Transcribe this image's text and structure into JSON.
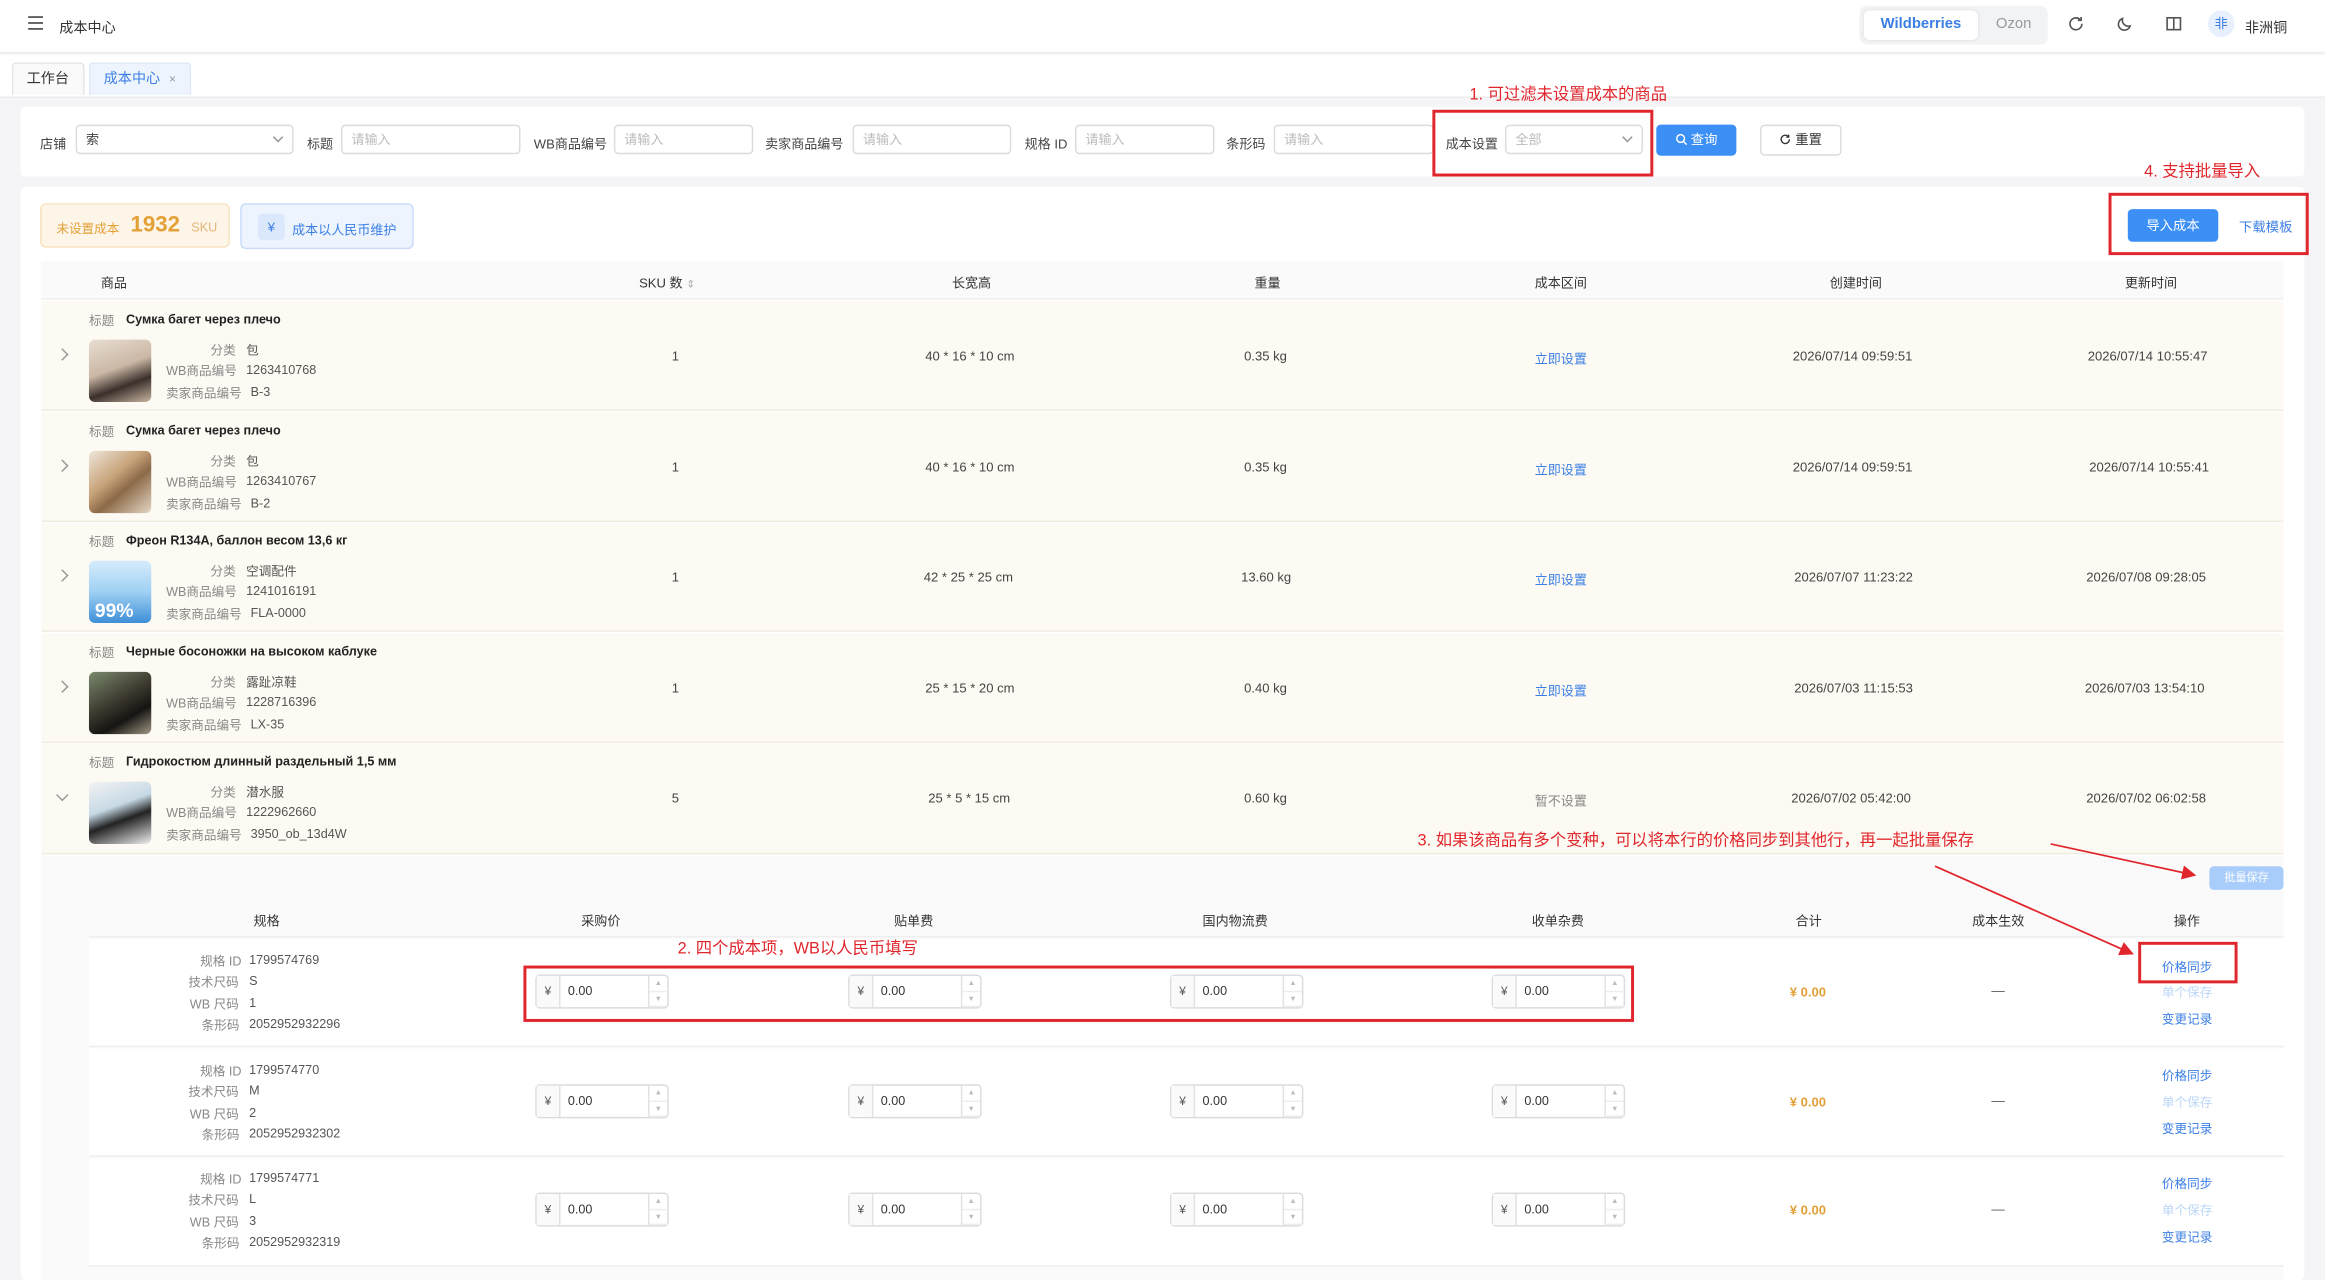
{
  "header": {
    "app_title": "成本中心",
    "platforms": [
      "Wildberries",
      "Ozon"
    ],
    "user_initial": "非",
    "user_name": "非洲铜"
  },
  "tabs": [
    {
      "label": "工作台"
    },
    {
      "label": "成本中心",
      "close": "×"
    }
  ],
  "filters": {
    "store_label": "店铺",
    "store_value": "索",
    "title_label": "标题",
    "title_placeholder": "请输入",
    "wb_id_label": "WB商品编号",
    "wb_id_placeholder": "请输入",
    "seller_id_label": "卖家商品编号",
    "seller_id_placeholder": "请输入",
    "spec_id_label": "规格 ID",
    "spec_id_placeholder": "请输入",
    "barcode_label": "条形码",
    "barcode_placeholder": "请输入",
    "cost_label": "成本设置",
    "cost_value": "全部",
    "query_button": "查询",
    "reset_button": "重置"
  },
  "summary": {
    "unset_label": "未设置成本",
    "unset_count": "1932",
    "unset_unit": "SKU",
    "rmb_symbol": "¥",
    "rmb_label": "成本以人民币维护",
    "import_button": "导入成本",
    "template_link": "下载模板"
  },
  "table": {
    "columns": [
      "商品",
      "SKU 数",
      "长宽高",
      "重量",
      "成本区间",
      "创建时间",
      "更新时间"
    ],
    "labels": {
      "title": "标题",
      "category": "分类",
      "wb_id": "WB商品编号",
      "seller_id": "卖家商品编号"
    },
    "rows": [
      {
        "title": "Сумка багет через плечо",
        "category": "包",
        "wb_id": "1263410768",
        "seller_id": "B-3",
        "sku": "1",
        "dims": "40 * 16 * 10 cm",
        "weight": "0.35 kg",
        "cost": "立即设置",
        "created": "2026/07/14 09:59:51",
        "updated": "2026/07/14 10:55:47"
      },
      {
        "title": "Сумка багет через плечо",
        "category": "包",
        "wb_id": "1263410767",
        "seller_id": "B-2",
        "sku": "1",
        "dims": "40 * 16 * 10 cm",
        "weight": "0.35 kg",
        "cost": "立即设置",
        "created": "2026/07/14 09:59:51",
        "updated": "2026/07/14 10:55:41"
      },
      {
        "title": "Фреон R134A, баллон весом 13,6 кг",
        "category": "空调配件",
        "wb_id": "1241016191",
        "seller_id": "FLA-0000",
        "sku": "1",
        "dims": "42 * 25 * 25 cm",
        "weight": "13.60 kg",
        "cost": "立即设置",
        "created": "2026/07/07 11:23:22",
        "updated": "2026/07/08 09:28:05",
        "thumb_text": "99%"
      },
      {
        "title": "Черные босоножки на высоком каблуке",
        "category": "露趾凉鞋",
        "wb_id": "1228716396",
        "seller_id": "LX-35",
        "sku": "1",
        "dims": "25 * 15 * 20 cm",
        "weight": "0.40 kg",
        "cost": "立即设置",
        "created": "2026/07/03 11:15:53",
        "updated": "2026/07/03 13:54:10"
      },
      {
        "title": "Гидрокостюм длинный раздельный 1,5 мм",
        "category": "潜水服",
        "wb_id": "1222962660",
        "seller_id": "3950_ob_13d4W",
        "sku": "5",
        "dims": "25 * 5 * 15 cm",
        "weight": "0.60 kg",
        "cost": "暂不设置",
        "created": "2026/07/02 05:42:00",
        "updated": "2026/07/02 06:02:58"
      }
    ]
  },
  "variants": {
    "batch_save": "批量保存",
    "columns": [
      "规格",
      "采购价",
      "贴单费",
      "国内物流费",
      "收单杂费",
      "合计",
      "成本生效",
      "操作"
    ],
    "labels": {
      "spec_id": "规格 ID",
      "tech_size": "技术尺码",
      "wb_size": "WB 尺码",
      "barcode": "条形码"
    },
    "currency": "¥",
    "ops": {
      "sync": "价格同步",
      "save": "单个保存",
      "log": "变更记录"
    },
    "rows": [
      {
        "spec_id": "1799574769",
        "tech_size": "S",
        "wb_size": "1",
        "barcode": "2052952932296",
        "purchase": "0.00",
        "label_fee": "0.00",
        "logistics": "0.00",
        "misc": "0.00",
        "total": "¥ 0.00",
        "effective": "—"
      },
      {
        "spec_id": "1799574770",
        "tech_size": "M",
        "wb_size": "2",
        "barcode": "2052952932302",
        "purchase": "0.00",
        "label_fee": "0.00",
        "logistics": "0.00",
        "misc": "0.00",
        "total": "¥ 0.00",
        "effective": "—"
      },
      {
        "spec_id": "1799574771",
        "tech_size": "L",
        "wb_size": "3",
        "barcode": "2052952932319",
        "purchase": "0.00",
        "label_fee": "0.00",
        "logistics": "0.00",
        "misc": "0.00",
        "total": "¥ 0.00",
        "effective": "—"
      }
    ]
  },
  "annotations": {
    "a1": "1. 可过滤未设置成本的商品",
    "a2": "2. 四个成本项，WB以人民币填写",
    "a3": "3. 如果该商品有多个变种，可以将本行的价格同步到其他行，再一起批量保存",
    "a4": "4. 支持批量导入"
  },
  "colors": {
    "accent": "#3b8ff5",
    "warning": "#e3a037",
    "annotation": "#e0262c"
  }
}
